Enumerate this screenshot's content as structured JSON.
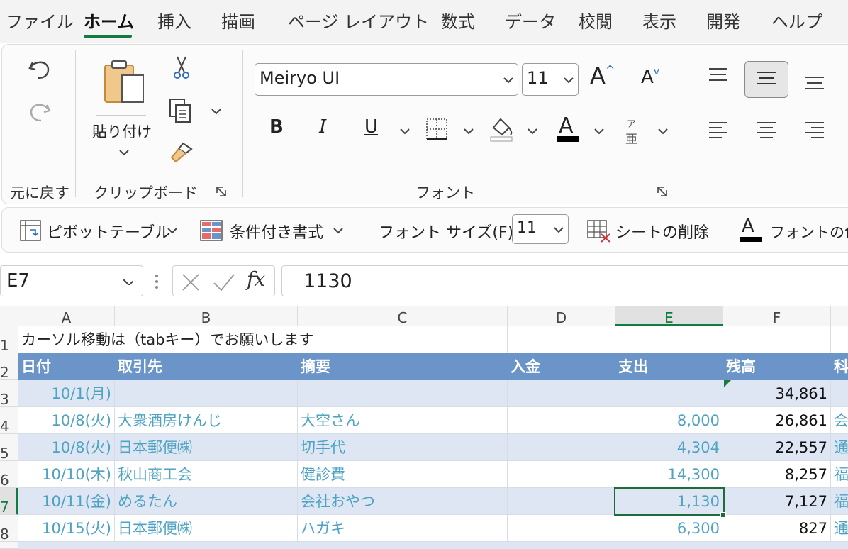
{
  "menu": {
    "tabs": [
      "ファイル",
      "ホーム",
      "挿入",
      "描画",
      "ページ レイアウト",
      "数式",
      "データ",
      "校閲",
      "表示",
      "開発",
      "ヘルプ"
    ],
    "active": "ホーム"
  },
  "ribbon": {
    "undo_group_label": "元に戻す",
    "paste_label": "貼り付け",
    "clipboard_group_label": "クリップボード",
    "font_name": "Meiryo UI",
    "font_size": "11",
    "font_group_label": "フォント",
    "phonetic_top": "ア",
    "phonetic_bottom": "亜",
    "bold": "B",
    "italic": "I",
    "underline": "U",
    "font_color_letter": "A"
  },
  "quick_access": {
    "pivot_label": "ピボットテーブル",
    "cond_format_label": "条件付き書式",
    "font_size_label": "フォント サイズ(F):",
    "font_size_value": "11",
    "delete_sheet_label": "シートの削除",
    "font_color_label": "フォントの色"
  },
  "formula_bar": {
    "name_box": "E7",
    "fx": "fx",
    "formula": "1130"
  },
  "sheet": {
    "columns": [
      "A",
      "B",
      "C",
      "D",
      "E",
      "F"
    ],
    "selected_column": "E",
    "selected_row": "7",
    "row_numbers": [
      "1",
      "2",
      "3",
      "4",
      "5",
      "6",
      "7",
      "8"
    ],
    "note": "カーソル移動は（tabキー）でお願いします",
    "headers": [
      "日付",
      "取引先",
      "摘要",
      "入金",
      "支出",
      "残高",
      "科"
    ],
    "rows": [
      {
        "date": "10/1(月)",
        "partner": "",
        "desc": "",
        "in": "",
        "out": "",
        "balance": "34,861",
        "cat": ""
      },
      {
        "date": "10/8(火)",
        "partner": "大衆酒房けんじ",
        "desc": "大空さん",
        "in": "",
        "out": "8,000",
        "balance": "26,861",
        "cat": "会"
      },
      {
        "date": "10/8(火)",
        "partner": "日本郵便㈱",
        "desc": "切手代",
        "in": "",
        "out": "4,304",
        "balance": "22,557",
        "cat": "通"
      },
      {
        "date": "10/10(木)",
        "partner": "秋山商工会",
        "desc": "健診費",
        "in": "",
        "out": "14,300",
        "balance": "8,257",
        "cat": "福"
      },
      {
        "date": "10/11(金)",
        "partner": "めるたん",
        "desc": "会社おやつ",
        "in": "",
        "out": "1,130",
        "balance": "7,127",
        "cat": "福"
      },
      {
        "date": "10/15(火)",
        "partner": "日本郵便㈱",
        "desc": "ハガキ",
        "in": "",
        "out": "6,300",
        "balance": "827",
        "cat": "通"
      }
    ]
  }
}
